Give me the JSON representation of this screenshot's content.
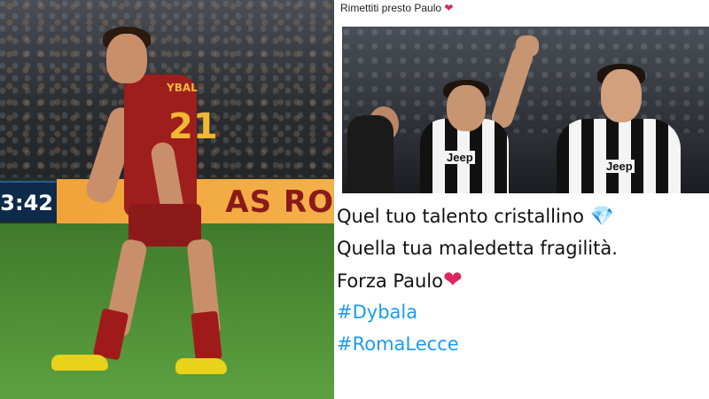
{
  "left_photo": {
    "scoreboard_time": "3:42",
    "ad_board_text": "AS RO",
    "shirt_name": "YBAL",
    "shirt_number": "21"
  },
  "tweet": {
    "header_text": "Rimettiti presto Paulo",
    "header_emoji": "❤",
    "photo": {
      "jersey_sponsor_1": "Jeep",
      "jersey_sponsor_2": "Jeep"
    },
    "lines": [
      {
        "text": "Quel tuo talento cristallino",
        "emoji": "💎"
      },
      {
        "text": "Quella tua maledetta fragilità.",
        "emoji": ""
      },
      {
        "text": "Forza Paulo",
        "emoji": "❤"
      }
    ],
    "hashtags": [
      "#Dybala",
      "#RomaLecce"
    ]
  },
  "colors": {
    "roma_red": "#9e1d1d",
    "roma_gold": "#f2b833",
    "hashtag_blue": "#1d9bf0",
    "heart_red": "#e0245e"
  }
}
